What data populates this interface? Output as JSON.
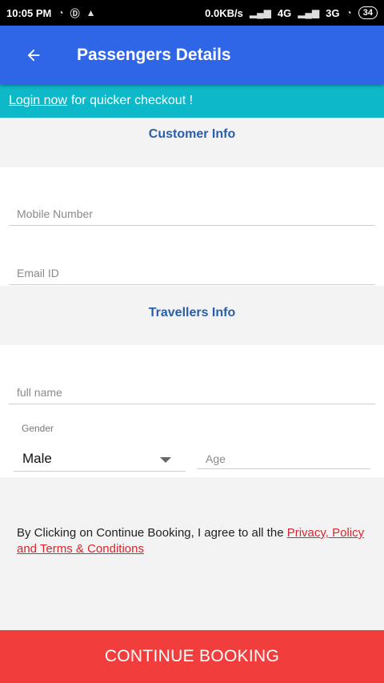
{
  "status_bar": {
    "time": "10:05 PM",
    "network_speed": "0.0KB/s",
    "network_4g": "4G",
    "network_3g": "3G",
    "battery": "34"
  },
  "app_bar": {
    "title": "Passengers Details"
  },
  "login_banner": {
    "link_text": "Login now",
    "text": "for quicker checkout !"
  },
  "customer_info": {
    "title": "Customer Info",
    "mobile_placeholder": "Mobile Number",
    "email_placeholder": "Email ID"
  },
  "travellers_info": {
    "title": "Travellers Info",
    "name_placeholder": "full name",
    "gender_label": "Gender",
    "gender_value": "Male",
    "age_placeholder": "Age"
  },
  "terms": {
    "text": "By Clicking on Continue Booking, I agree to all the",
    "link_text": "Privacy, Policy and Terms & Conditions"
  },
  "continue_button": {
    "label": "CONTINUE BOOKING"
  },
  "colors": {
    "app_bar": "#2f66e8",
    "banner": "#0db8c8",
    "section_title": "#2b5ea8",
    "link_red": "#d9262c",
    "button_red": "#f23d3d"
  }
}
